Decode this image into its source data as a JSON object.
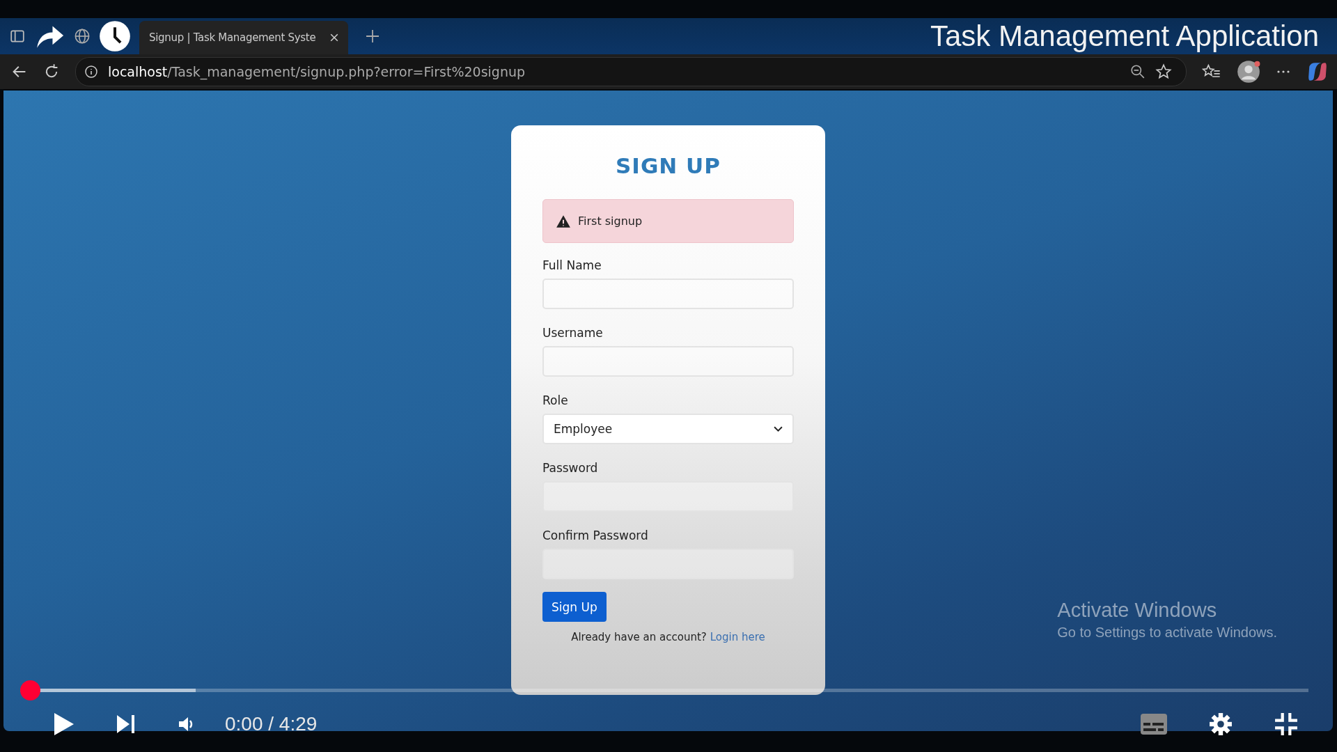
{
  "browser": {
    "tabs": [
      {
        "label": "Signup | Task Management Syste",
        "selected": true
      }
    ],
    "address": "**localhost**/Task_management/signup.php?error=First%20signup"
  },
  "video": {
    "title": "Task Management Application",
    "time": "0:00 / 4:29",
    "progress": {
      "level": 0
    }
  },
  "form": {
    "title": "SIGN UP",
    "alert": {
      "kind": "warning",
      "text": "First signup"
    },
    "fields": [
      {
        "label": "Full Name",
        "kind": "text"
      },
      {
        "label": "Username",
        "kind": "text"
      },
      {
        "label": "Role",
        "kind": "select",
        "value": "Employee"
      },
      {
        "label": "Password",
        "kind": "text"
      },
      {
        "label": "Confirm Password",
        "kind": "text"
      }
    ],
    "submit": "Sign Up",
    "footer": {
      "text": "Already have an account?",
      "link": "Login here"
    }
  },
  "notice": {
    "title": "Activate Windows",
    "text": "Go to Settings to activate Windows."
  }
}
